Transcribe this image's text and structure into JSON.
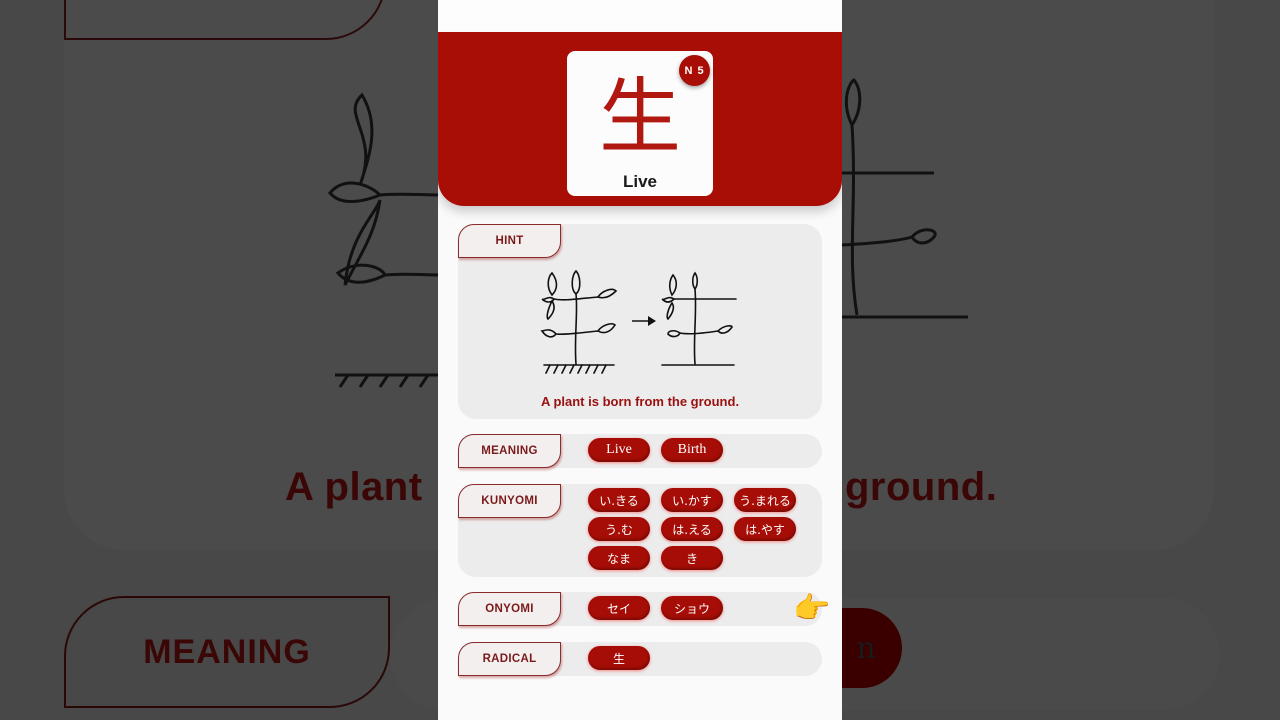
{
  "kanji": {
    "character": "生",
    "keyword": "Live",
    "level": "N 5"
  },
  "hint": {
    "label": "HINT",
    "text": "A plant is born from the ground.",
    "arrow_icon": "right-arrow-icon"
  },
  "meaning": {
    "label": "MEANING",
    "values": [
      "Live",
      "Birth"
    ]
  },
  "kunyomi": {
    "label": "KUNYOMI",
    "values": [
      "い.きる",
      "い.かす",
      "う.まれる",
      "う.む",
      "は.える",
      "は.やす",
      "なま",
      "き"
    ]
  },
  "onyomi": {
    "label": "ONYOMI",
    "values": [
      "セイ",
      "ショウ"
    ]
  },
  "radical": {
    "label": "RADICAL",
    "values": [
      "生"
    ]
  },
  "pointer_icon": "👉",
  "colors": {
    "brand_red": "#a80d06",
    "background": "#484848",
    "section_bg": "#ececec"
  },
  "background_copy": {
    "hint_text_left": "A plant",
    "hint_text_right": "ground.",
    "meaning_label": "MEANING",
    "pill_fragment": "n"
  }
}
